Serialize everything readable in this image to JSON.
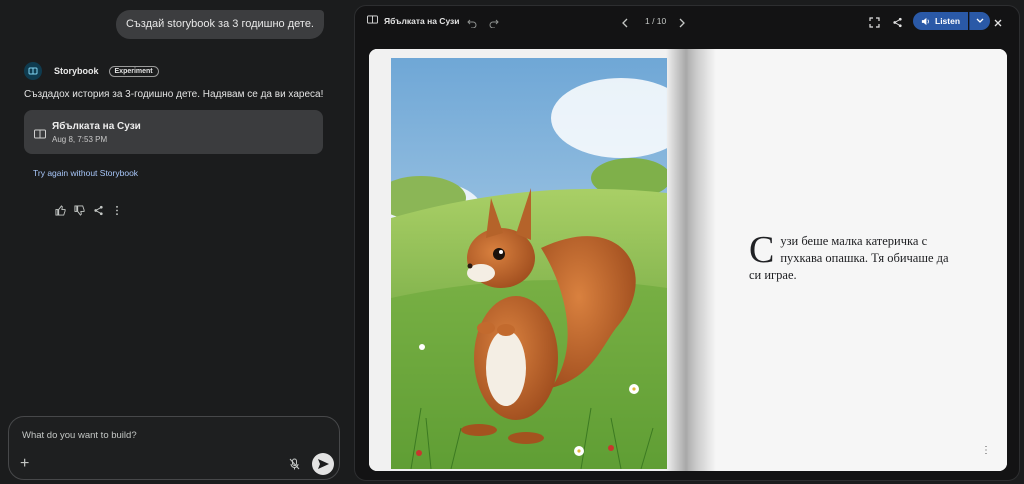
{
  "chat": {
    "user_message": "Създай storybook за 3 годишно дете.",
    "app_name": "Storybook",
    "app_badge": "Experiment",
    "reply": "Създадох история за 3-годишно дете. Надявам се да ви хареса!",
    "card": {
      "title": "Ябълката на Сузи",
      "date": "Aug 8, 7:53 PM"
    },
    "try_again": "Try again without Storybook",
    "feedback_icons": [
      "thumb-up-icon",
      "thumb-down-icon",
      "share-icon",
      "more-vert-icon"
    ]
  },
  "composer": {
    "placeholder": "What do you want to build?"
  },
  "viewer": {
    "title": "Ябълката на Сузи",
    "page_indicator": "1 / 10",
    "listen_label": "Listen",
    "accent": "#2a59a7"
  },
  "book": {
    "dropcap": "С",
    "text": "узи беше малка катеричка с пухкава опашка. Тя обичаше да си играе.",
    "page_menu": "⋮"
  }
}
